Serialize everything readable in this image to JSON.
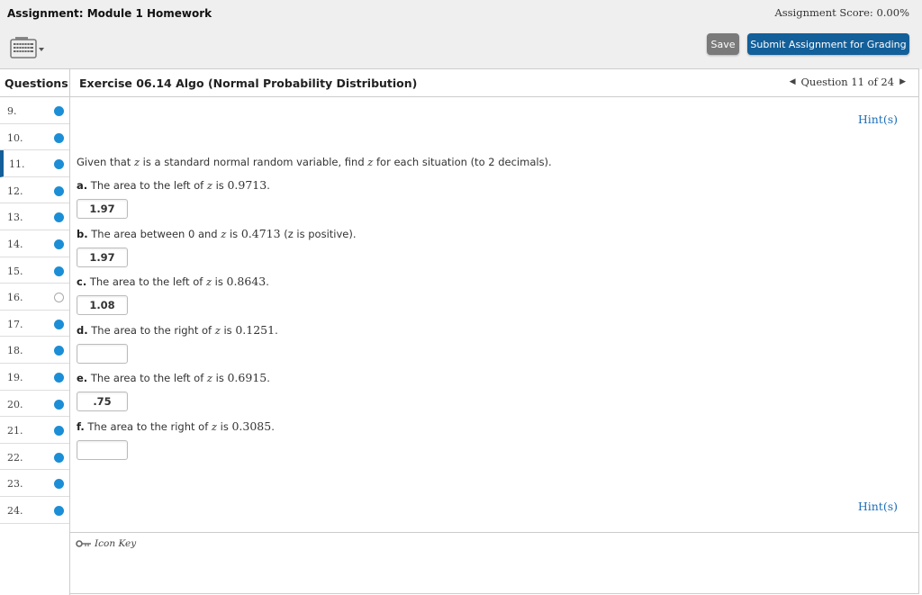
{
  "topbar": {
    "assignment_title": "Assignment: Module 1 Homework",
    "score": "Assignment Score: 0.00%",
    "keyboard_icon": "keyboard-icon",
    "save_label": "Save",
    "submit_label": "Submit Assignment for Grading",
    "colors": {
      "submit_bg": "#135f99",
      "save_bg": "#7a7a7a"
    }
  },
  "header": {
    "questions_label": "Questions",
    "exercise_title": "Exercise 06.14 Algo (Normal Probability Distribution)",
    "question_nav": "Question 11 of 24",
    "prev_icon": "◀",
    "next_icon": "▶"
  },
  "sidebar": {
    "active": "11.",
    "items": [
      {
        "label": "9.",
        "answered": true
      },
      {
        "label": "10.",
        "answered": true
      },
      {
        "label": "11.",
        "answered": true
      },
      {
        "label": "12.",
        "answered": true
      },
      {
        "label": "13.",
        "answered": true
      },
      {
        "label": "14.",
        "answered": true
      },
      {
        "label": "15.",
        "answered": true
      },
      {
        "label": "16.",
        "answered": false
      },
      {
        "label": "17.",
        "answered": true
      },
      {
        "label": "18.",
        "answered": true
      },
      {
        "label": "19.",
        "answered": true
      },
      {
        "label": "20.",
        "answered": true
      },
      {
        "label": "21.",
        "answered": true
      },
      {
        "label": "22.",
        "answered": true
      },
      {
        "label": "23.",
        "answered": true
      },
      {
        "label": "24.",
        "answered": true
      }
    ]
  },
  "content": {
    "hint_label": "Hint(s)",
    "intro_pre": "Given that ",
    "intro_var": "z",
    "intro_mid": " is a standard normal random variable, find ",
    "intro_var2": "z",
    "intro_post": " for each situation (to 2 decimals).",
    "parts": [
      {
        "letter": "a.",
        "text_pre": " The area to the left of ",
        "var": "z",
        "text_mid": " is ",
        "value": "0.9713",
        "text_post": ".",
        "answer": "1.97"
      },
      {
        "letter": "b.",
        "text_pre": " The area between 0 and ",
        "var": "z",
        "text_mid": " is ",
        "value": "0.4713",
        "text_post": " (z is positive).",
        "answer": "1.97"
      },
      {
        "letter": "c.",
        "text_pre": " The area to the left of ",
        "var": "z",
        "text_mid": " is ",
        "value": "0.8643",
        "text_post": ".",
        "answer": "1.08"
      },
      {
        "letter": "d.",
        "text_pre": " The area to the right of ",
        "var": "z",
        "text_mid": " is ",
        "value": "0.1251",
        "text_post": ".",
        "answer": ""
      },
      {
        "letter": "e.",
        "text_pre": " The area to the left of ",
        "var": "z",
        "text_mid": " is ",
        "value": "0.6915",
        "text_post": ".",
        "answer": ".75"
      },
      {
        "letter": "f.",
        "text_pre": " The area to the right of ",
        "var": "z",
        "text_mid": " is ",
        "value": "0.3085",
        "text_post": ".",
        "answer": ""
      }
    ]
  },
  "footer": {
    "icon_key_label": "Icon Key",
    "icon": "key-icon"
  }
}
